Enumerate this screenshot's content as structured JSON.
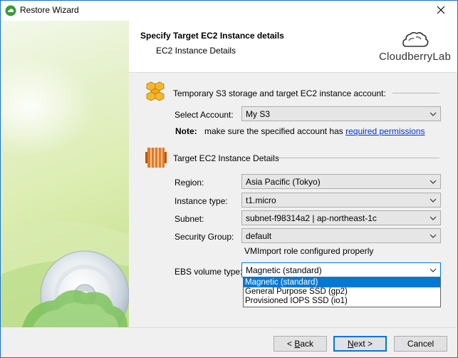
{
  "window": {
    "title": "Restore Wizard"
  },
  "header": {
    "title": "Specify Target EC2 Instance details",
    "subtitle": "EC2 Instance Details",
    "logo_text": "CloudberryLab"
  },
  "s3_section": {
    "title": "Temporary S3 storage and target EC2 instance account:",
    "account_label": "Select Account:",
    "account_value": "My S3",
    "note_label": "Note:",
    "note_text": "make sure the specified account has",
    "note_link": "required permissions"
  },
  "ec2_section": {
    "title": "Target EC2 Instance Details",
    "region_label": "Region:",
    "region_value": "Asia Pacific (Tokyo)",
    "instance_type_label": "Instance type:",
    "instance_type_value": "t1.micro",
    "subnet_label": "Subnet:",
    "subnet_value": "subnet-f98314a2 | ap-northeast-1c",
    "security_group_label": "Security Group:",
    "security_group_value": "default",
    "vmimport_status": "VMImport role configured properly",
    "ebs_label": "EBS volume type:",
    "ebs_value": "Magnetic (standard)",
    "ebs_options": [
      "Magnetic (standard)",
      "General Purpose SSD (gp2)",
      "Provisioned IOPS SSD (io1)"
    ]
  },
  "footer": {
    "back_prefix": "< ",
    "back_underlined": "B",
    "back_rest": "ack",
    "next_underlined": "N",
    "next_rest": "ext >",
    "cancel": "Cancel"
  },
  "colors": {
    "accent": "#0078d7",
    "link": "#0033cc",
    "aws_orange": "#e07b24",
    "s3_gold": "#f0a81c"
  }
}
